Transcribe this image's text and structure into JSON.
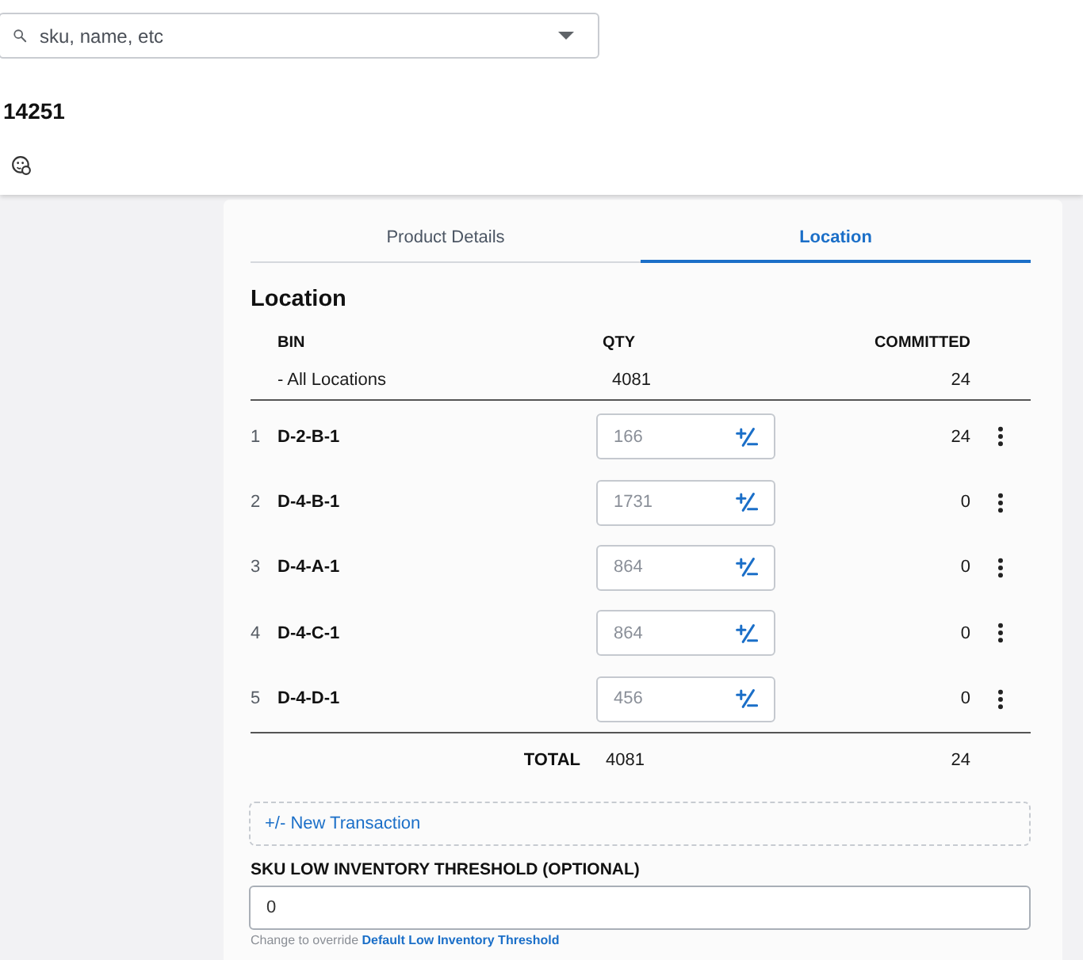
{
  "search": {
    "placeholder": "sku, name, etc"
  },
  "product": {
    "sku": "14251"
  },
  "tabs": [
    {
      "label": "Product Details",
      "selected": false
    },
    {
      "label": "Location",
      "selected": true
    }
  ],
  "location": {
    "title": "Location",
    "columns": [
      "BIN",
      "QTY",
      "COMMITTED"
    ],
    "summary": {
      "bin": "- All Locations",
      "qty": "4081",
      "committed": "24"
    },
    "rows": [
      {
        "index": "1",
        "bin": "D-2-B-1",
        "qty_field": {
          "placeholder": "166"
        },
        "committed": "24"
      },
      {
        "index": "2",
        "bin": "D-4-B-1",
        "qty_field": {
          "placeholder": "1731"
        },
        "committed": "0"
      },
      {
        "index": "3",
        "bin": "D-4-A-1",
        "qty_field": {
          "placeholder": "864"
        },
        "committed": "0"
      },
      {
        "index": "4",
        "bin": "D-4-C-1",
        "qty_field": {
          "placeholder": "864"
        },
        "committed": "0"
      },
      {
        "index": "5",
        "bin": "D-4-D-1",
        "qty_field": {
          "placeholder": "456"
        },
        "committed": "0"
      }
    ],
    "total": {
      "label": "TOTAL",
      "qty": "4081",
      "committed": "24"
    }
  },
  "new_transaction": {
    "label": "+/- New Transaction"
  },
  "threshold": {
    "label": "SKU LOW INVENTORY THRESHOLD (OPTIONAL)",
    "value": "0",
    "help": "Change to override",
    "link": "Default Low Inventory Threshold"
  }
}
